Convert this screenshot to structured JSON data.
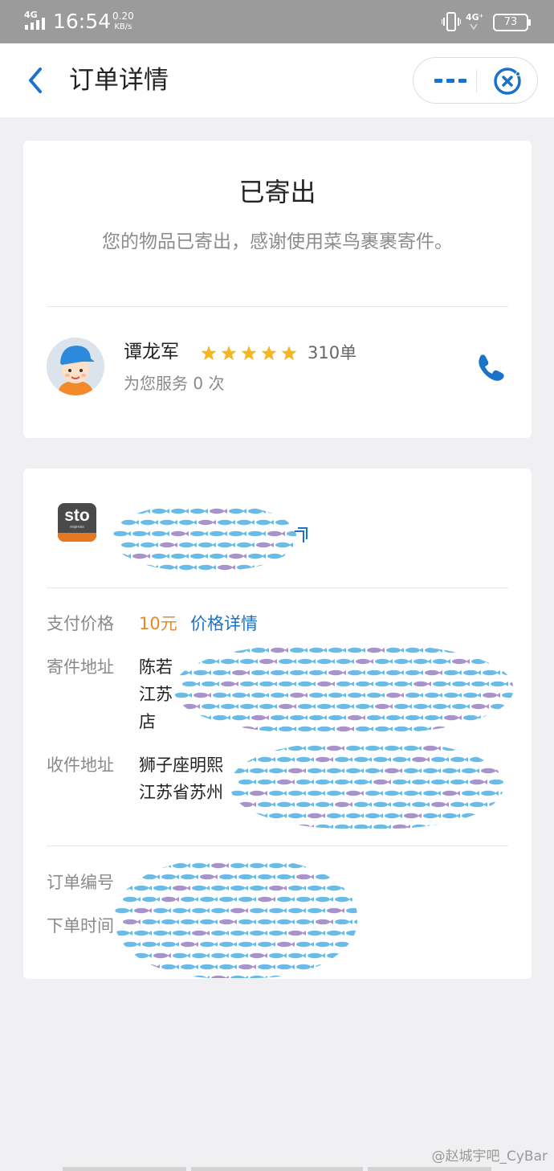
{
  "status_bar": {
    "network": "4G",
    "time": "16:54",
    "speed_value": "0.20",
    "speed_unit": "KB/s",
    "network_right": "4G⁺",
    "battery": "73"
  },
  "nav": {
    "title": "订单详情",
    "icons": {
      "back": "chevron-left-icon",
      "more": "more-dots-icon",
      "close": "close-circle-icon"
    },
    "accent_color": "#1a73c9"
  },
  "status_card": {
    "title": "已寄出",
    "description": "您的物品已寄出，感谢使用菜鸟裹裹寄件。"
  },
  "courier": {
    "name": "谭龙军",
    "rating": 5,
    "orders": "310单",
    "service_text": "为您服务 0 次",
    "icons": {
      "avatar": "courier-avatar",
      "phone": "phone-icon",
      "star": "star-icon"
    },
    "star_color": "#f5b623"
  },
  "detail_card": {
    "carrier_logo": {
      "text": "sto",
      "subtext": "express"
    },
    "fields": {
      "price_label": "支付价格",
      "price_value": "10元",
      "price_link": "价格详情",
      "sender_label": "寄件地址",
      "sender_lines": [
        "陈若",
        "江苏",
        "店"
      ],
      "receiver_label": "收件地址",
      "receiver_lines": [
        "狮子座明熙",
        "江苏省苏州"
      ],
      "order_no_label": "订单编号",
      "order_time_label": "下单时间"
    },
    "price_color": "#e38a2a"
  },
  "watermark": "@赵城宇吧_CyBar"
}
